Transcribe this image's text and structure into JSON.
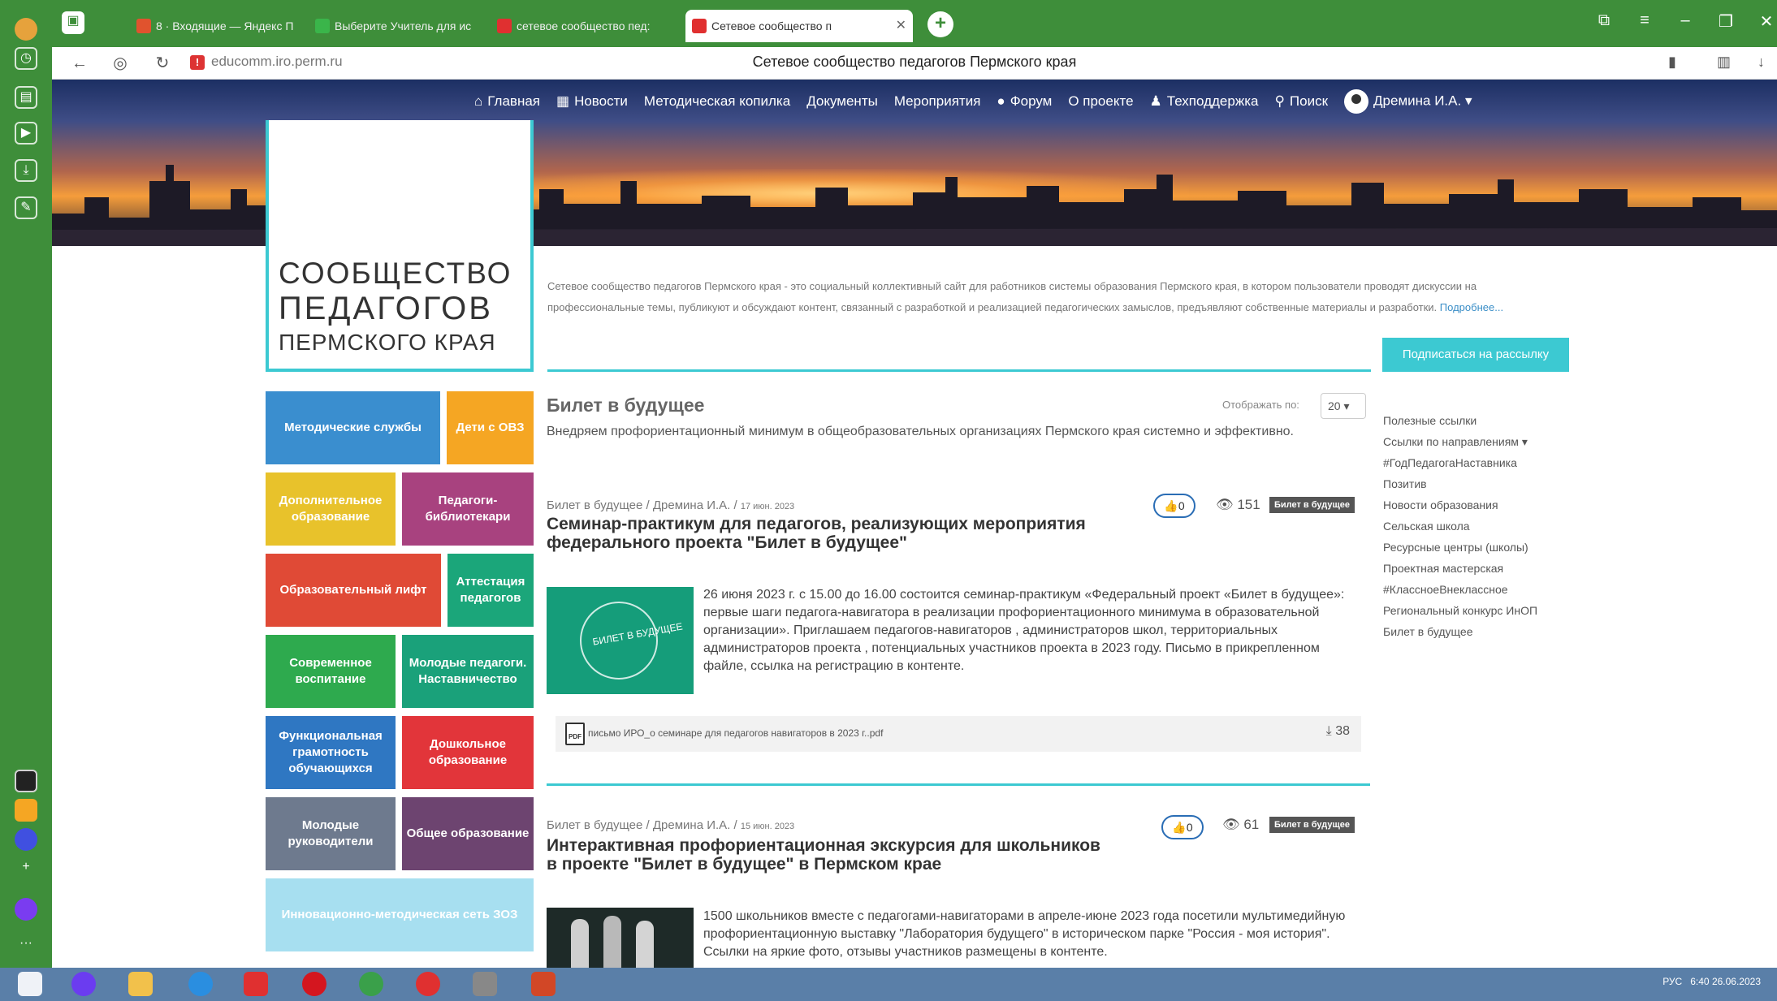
{
  "browser": {
    "tabs": [
      {
        "label": "8 · Входящие — Яндекс П",
        "color": "#e0532e"
      },
      {
        "label": "Выберите Учитель для ис",
        "color": "#3ab54a"
      },
      {
        "label": "сетевое сообщество пед:",
        "color": "#e03030"
      },
      {
        "label": "Сетевое сообщество п",
        "color": "#e03030"
      }
    ],
    "url": "educomm.iro.perm.ru",
    "page_title": "Сетевое сообщество педагогов Пермского края"
  },
  "nav": {
    "items": [
      "Главная",
      "Новости",
      "Методическая копилка",
      "Документы",
      "Мероприятия",
      "Форум",
      "О проекте",
      "Техподдержка",
      "Поиск"
    ],
    "user": "Дремина И.А."
  },
  "logo": {
    "line1": "СООБЩЕСТВО",
    "line2": "ПЕДАГОГОВ",
    "line3": "ПЕРМСКОГО КРАЯ"
  },
  "intro": {
    "text": "Сетевое сообщество педагогов Пермского края - это социальный коллективный сайт для работников системы образования Пермского края, в котором пользователи проводят дискуссии на профессиональные темы, публикуют и обсуждают контент, связанный с разработкой и реализацией педагогических замыслов, предъявляют собственные материалы и разработки.",
    "more": "Подробнее..."
  },
  "subscribe": "Подписаться на рассылку",
  "tiles": [
    {
      "label": "Методические службы",
      "color": "#3a8ecf"
    },
    {
      "label": "Дети с ОВЗ",
      "color": "#f5a623"
    },
    {
      "label": "Дополнительное образование",
      "color": "#e8c22b"
    },
    {
      "label": "Педагоги-библиотекари",
      "color": "#a8427f"
    },
    {
      "label": "Образовательный лифт",
      "color": "#e04a36"
    },
    {
      "label": "Аттестация педагогов",
      "color": "#1ba67a"
    },
    {
      "label": "Современное воспитание",
      "color": "#2eaa4e"
    },
    {
      "label": "Молодые педагоги. Наставничество",
      "color": "#1aa17a"
    },
    {
      "label": "Функциональная грамотность обучающихся",
      "color": "#2f77c2"
    },
    {
      "label": "Дошкольное образование",
      "color": "#e2353a"
    },
    {
      "label": "Молодые руководители",
      "color": "#6e7a8e"
    },
    {
      "label": "Общее образование",
      "color": "#6d4470"
    },
    {
      "label": "Инновационно-методическая сеть ЗОЗ",
      "color": "#a7dff0"
    }
  ],
  "section": {
    "title": "Билет в будущее",
    "desc": "Внедряем профориентационный минимум в общеобразовательных организациях Пермского края системно и эффективно.",
    "show_label": "Отображать по:",
    "per_page": "20"
  },
  "posts": [
    {
      "meta": "Билет в будущее / Дремина И.А. /",
      "date": "17 июн. 2023",
      "likes": "0",
      "views": "151",
      "badge": "Билет в будущее",
      "title_line1": "Семинар-практикум для педагогов, реализующих мероприятия",
      "title_line2": "федерального проекта \"Билет в будущее\"",
      "thumb_text": "БИЛЕТ В БУДУЩЕЕ",
      "body": "26 июня 2023 г. с 15.00 до 16.00 состоится семинар-практикум «Федеральный проект «Билет в будущее»: первые шаги педагога-навигатора в реализации профориентационного минимума в образовательной организации». Приглашаем педагогов-навигаторов , администраторов школ, территориальных администраторов проекта , потенциальных участников проекта в 2023 году. Письмо в прикрепленном файле, ссылка на регистрацию в контенте.",
      "attachment": "письмо ИРО_о семинаре для педагогов навигаторов в 2023 г..pdf",
      "downloads": "38"
    },
    {
      "meta": "Билет в будущее / Дремина И.А. /",
      "date": "15 июн. 2023",
      "likes": "0",
      "views": "61",
      "badge": "Билет в будущее",
      "title_line1": "Интерактивная профориентационная экскурсия для школьников",
      "title_line2": "в проекте \"Билет в будущее\" в Пермском крае",
      "body": "1500 школьников вместе с педагогами-навигаторами в апреле-июне 2023 года посетили мультимедийную профориентационную выставку \"Лаборатория будущего\" в историческом парке \"Россия - моя история\". Ссылки на яркие фото, отзывы участников размещены в контенте."
    }
  ],
  "sidebar_links": [
    "Полезные ссылки",
    "Ссылки по направлениям ▾",
    "#ГодПедагогаНаставника",
    "Позитив",
    "Новости образования",
    "Сельская школа",
    "Ресурсные центры (школы)",
    "Проектная мастерская",
    "#КлассноеВнеклассное",
    "Региональный конкурс ИнОП",
    "Билет в будущее"
  ],
  "taskbar": {
    "lang": "РУС",
    "time": "6:40",
    "date": "26.06.2023"
  },
  "accent": "#3cc9d2"
}
